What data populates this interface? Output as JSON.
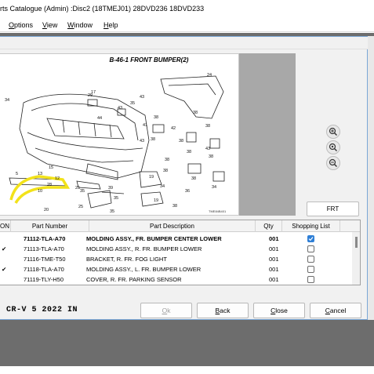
{
  "window": {
    "title": "rts Catalogue  (Admin)  :Disc2  (18TMEJ01)  28DVD236  18DVD233"
  },
  "menu": [
    {
      "label": "Options",
      "accel": "O",
      "rest": "ptions"
    },
    {
      "label": "View",
      "accel": "V",
      "rest": "iew"
    },
    {
      "label": "Window",
      "accel": "W",
      "rest": "indow"
    },
    {
      "label": "Help",
      "accel": "H",
      "rest": "elp"
    }
  ],
  "diagram": {
    "title": "B-46-1 FRONT BUMPER(2)",
    "code": "TME84B401",
    "callouts": [
      "17",
      "29",
      "34",
      "43",
      "43",
      "44",
      "41",
      "43",
      "35",
      "25",
      "38",
      "38",
      "38",
      "38",
      "38",
      "24",
      "42",
      "5",
      "13",
      "15",
      "28",
      "12",
      "10",
      "20",
      "35",
      "39",
      "35",
      "25",
      "35",
      "38",
      "38",
      "38",
      "38",
      "38",
      "36",
      "34",
      "19",
      "19",
      "38",
      "34",
      "43"
    ]
  },
  "zoom": [
    {
      "name": "zoom-in",
      "glyph": "+"
    },
    {
      "name": "zoom-fit",
      "glyph": "+"
    },
    {
      "name": "zoom-out",
      "glyph": "−"
    }
  ],
  "frt_label": "FRT",
  "table": {
    "columns": [
      "ON",
      "Part Number",
      "Part Description",
      "Qty",
      "Shopping List"
    ],
    "rows": [
      {
        "on": "",
        "part": "71112-TLA-A70",
        "desc": "MOLDING ASSY., FR. BUMPER CENTER LOWER",
        "qty": "001",
        "checked": true,
        "selected": true
      },
      {
        "on": "✔",
        "part": "71113-TLA-A70",
        "desc": "MOLDING ASSY., R. FR. BUMPER LOWER",
        "qty": "001",
        "checked": false,
        "selected": false
      },
      {
        "on": "",
        "part": "71116-TME-T50",
        "desc": "BRACKET, R. FR. FOG LIGHT",
        "qty": "001",
        "checked": false,
        "selected": false
      },
      {
        "on": "✔",
        "part": "71118-TLA-A70",
        "desc": "MOLDING ASSY., L. FR. BUMPER LOWER",
        "qty": "001",
        "checked": false,
        "selected": false
      },
      {
        "on": "",
        "part": "71119-TLY-H50",
        "desc": "COVER, R. FR. PARKING SENSOR",
        "qty": "001",
        "checked": false,
        "selected": false
      }
    ]
  },
  "model": "CR-V  5  2022  IN",
  "buttons": {
    "ok": {
      "label": "Ok",
      "accel": "O",
      "rest": "k"
    },
    "back": {
      "label": "Back",
      "accel": "B",
      "rest": "ack"
    },
    "close": {
      "label": "Close",
      "accel": "C",
      "rest": "lose"
    },
    "cancel": {
      "label": "Cancel",
      "accel": "C",
      "rest": "ancel"
    }
  },
  "colors": {
    "highlight": "#f2e21a",
    "checkbox_checked": "#2f7fd6",
    "workspace": "#6d6d6d"
  }
}
